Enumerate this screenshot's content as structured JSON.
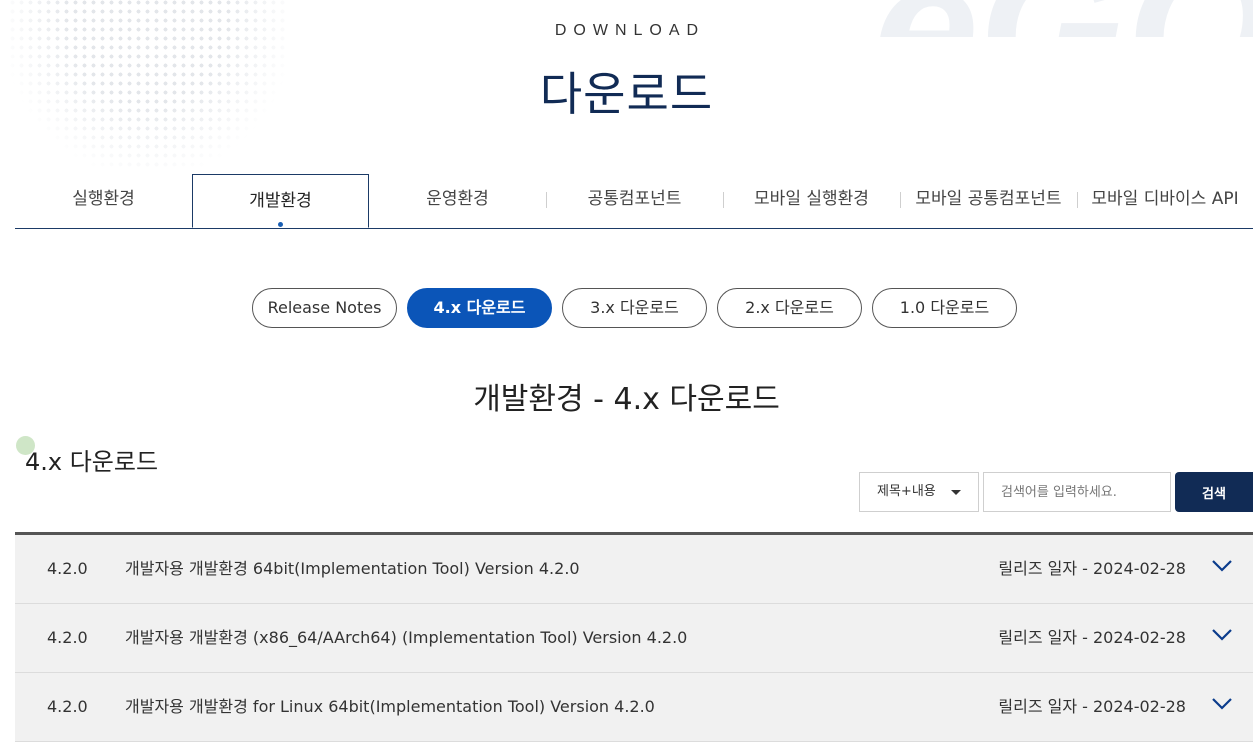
{
  "header": {
    "eyebrow": "DOWNLOAD",
    "title": "다운로드",
    "watermark_text": "eGOV"
  },
  "tabs": [
    {
      "label": "실행환경",
      "active": false
    },
    {
      "label": "개발환경",
      "active": true
    },
    {
      "label": "운영환경",
      "active": false
    },
    {
      "label": "공통컴포넌트",
      "active": false
    },
    {
      "label": "모바일 실행환경",
      "active": false
    },
    {
      "label": "모바일 공통컴포넌트",
      "active": false
    },
    {
      "label": "모바일 디바이스 API",
      "active": false
    }
  ],
  "version_tabs": [
    {
      "label": "Release Notes",
      "active": false
    },
    {
      "label": "4.x 다운로드",
      "active": true
    },
    {
      "label": "3.x 다운로드",
      "active": false
    },
    {
      "label": "2.x 다운로드",
      "active": false
    },
    {
      "label": "1.0 다운로드",
      "active": false
    }
  ],
  "section_title": "개발환경 - 4.x 다운로드",
  "sub_title": "4.x 다운로드",
  "search": {
    "select_value": "제목+내용",
    "placeholder": "검색어를 입력하세요.",
    "button_label": "검색"
  },
  "downloads": [
    {
      "version": "4.2.0",
      "title": "개발자용 개발환경 64bit(Implementation Tool) Version 4.2.0",
      "date": "릴리즈 일자 - 2024-02-28"
    },
    {
      "version": "4.2.0",
      "title": "개발자용 개발환경 (x86_64/AArch64) (Implementation Tool) Version 4.2.0",
      "date": "릴리즈 일자 - 2024-02-28"
    },
    {
      "version": "4.2.0",
      "title": "개발자용 개발환경 for Linux 64bit(Implementation Tool) Version 4.2.0",
      "date": "릴리즈 일자 - 2024-02-28"
    }
  ],
  "colors": {
    "navy": "#112b55",
    "accent_blue": "#0b55b8",
    "row_background": "#f1f1f1"
  }
}
